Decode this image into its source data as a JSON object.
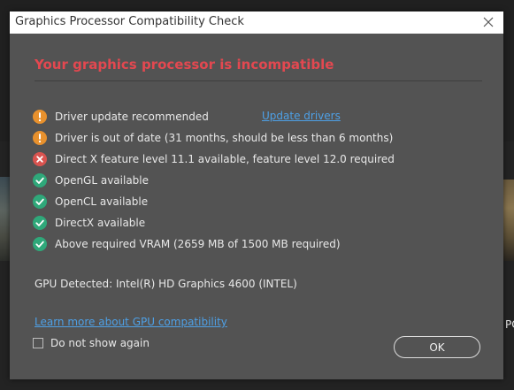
{
  "dialog": {
    "title": "Graphics Processor Compatibility Check",
    "headline": "Your graphics processor is incompatible",
    "checks": [
      {
        "status": "warning",
        "text": "Driver update recommended",
        "link": "Update drivers"
      },
      {
        "status": "warning",
        "text": "Driver is out of date (31 months, should be less than 6 months)"
      },
      {
        "status": "error",
        "text": "Direct X feature level 11.1 available, feature level 12.0 required"
      },
      {
        "status": "ok",
        "text": "OpenGL available"
      },
      {
        "status": "ok",
        "text": "OpenCL available"
      },
      {
        "status": "ok",
        "text": "DirectX available"
      },
      {
        "status": "ok",
        "text": "Above required VRAM (2659 MB of 1500 MB required)"
      }
    ],
    "gpu_detected": "GPU Detected: Intel(R) HD Graphics 4600 (INTEL)",
    "learn_more_link": "Learn more about GPU compatibility",
    "dont_show_label": "Do not show again",
    "dont_show_checked": false,
    "ok_label": "OK"
  },
  "background": {
    "right_text": "PC"
  },
  "colors": {
    "dialog_bg": "#535353",
    "headline": "#e34850",
    "warning": "#e8912d",
    "error": "#d9534f",
    "ok": "#2fa87a",
    "link": "#4ea0e6"
  },
  "icons": {
    "warning": "warning-icon",
    "error": "error-icon",
    "ok": "check-circle-icon",
    "close": "close-icon"
  }
}
